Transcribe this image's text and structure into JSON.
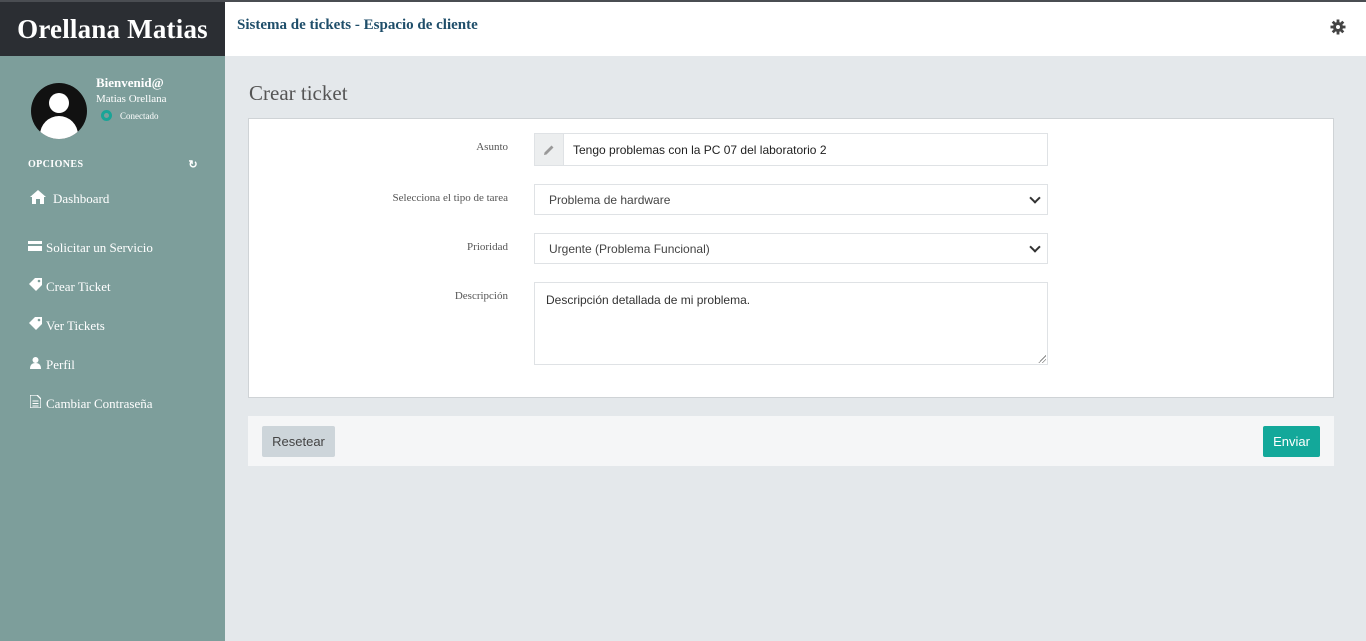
{
  "sidebar": {
    "brand": "Orellana Matias",
    "welcome": "Bienvenid@",
    "user_name": "Matias Orellana",
    "status": "Conectado",
    "status_color": "#1aa597",
    "options_label": "OPCIONES",
    "items": [
      {
        "label": "Dashboard",
        "icon": "home-icon"
      },
      {
        "label": "Solicitar un Servicio",
        "icon": "credit-card-icon"
      },
      {
        "label": "Crear Ticket",
        "icon": "tag-icon"
      },
      {
        "label": "Ver Tickets",
        "icon": "tag-icon"
      },
      {
        "label": "Perfil",
        "icon": "user-icon"
      },
      {
        "label": "Cambiar Contraseña",
        "icon": "document-icon"
      }
    ]
  },
  "header": {
    "title": "Sistema de tickets - Espacio de cliente",
    "settings_icon": "gear-icon"
  },
  "main": {
    "page_title": "Crear ticket",
    "form": {
      "subject_label": "Asunto",
      "subject_value": "Tengo problemas con la PC 07 del laboratorio 2",
      "task_type_label": "Selecciona el tipo de tarea",
      "task_type_value": "Problema de hardware",
      "priority_label": "Prioridad",
      "priority_value": "Urgente (Problema Funcional)",
      "description_label": "Descripción",
      "description_value": "Descripción detallada de mi problema."
    },
    "buttons": {
      "reset": "Resetear",
      "send": "Enviar"
    }
  },
  "colors": {
    "sidebar_bg": "#7d9e9b",
    "brand_bg": "#2b2e33",
    "accent": "#13a89a",
    "header_title": "#1f4e6a"
  }
}
